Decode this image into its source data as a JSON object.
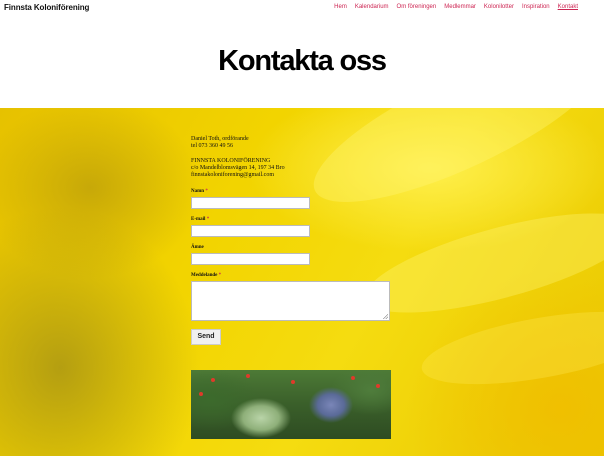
{
  "header": {
    "site_title": "Finnsta Koloniförening",
    "nav": [
      {
        "label": "Hem"
      },
      {
        "label": "Kalendarium"
      },
      {
        "label": "Om föreningen"
      },
      {
        "label": "Medlemmar"
      },
      {
        "label": "Kolonilotter"
      },
      {
        "label": "Inspiration"
      },
      {
        "label": "Kontakt"
      }
    ],
    "current": "Kontakt"
  },
  "page": {
    "title": "Kontakta oss"
  },
  "contact": {
    "person": "Daniel Toth, ordförande",
    "phone": "tel 073 360 49 56",
    "org": "FINNSTA KOLONIFÖRENING",
    "address": "c/o Mandelblomsvägen 14, 197 34 Bro",
    "email": "finnstakoloniforening@gmail.com"
  },
  "form": {
    "name_label": "Namn",
    "email_label": "E-mail",
    "subject_label": "Ämne",
    "message_label": "Meddelande",
    "required_mark": "*",
    "name_value": "",
    "email_value": "",
    "subject_value": "",
    "message_value": "",
    "send_label": "Send"
  },
  "colors": {
    "accent": "#cd2653",
    "background_band": "#f2d400"
  }
}
